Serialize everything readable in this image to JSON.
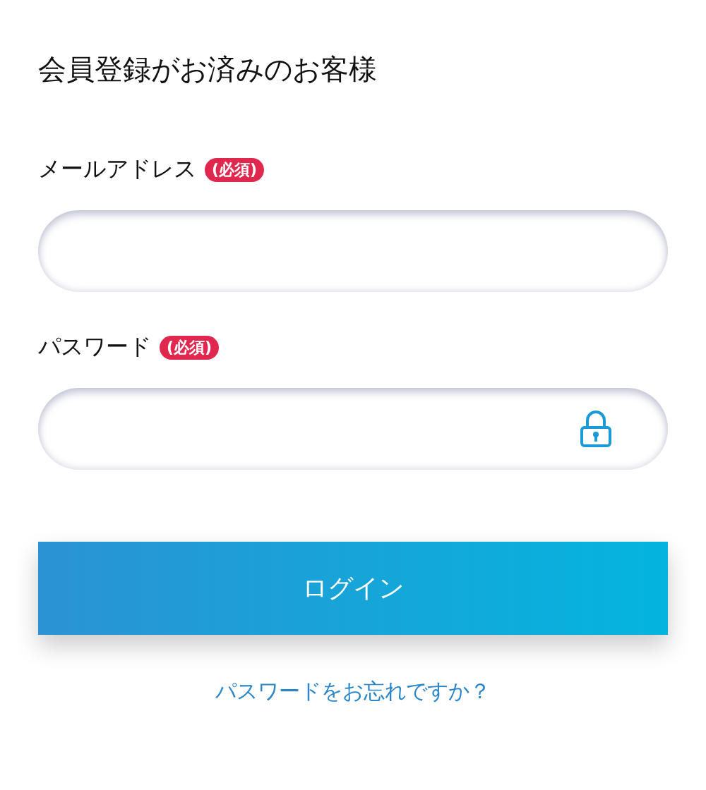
{
  "heading": "会員登録がお済みのお客様",
  "fields": [
    {
      "kind": "email",
      "label": "メールアドレス",
      "badge": "(必須)"
    },
    {
      "kind": "password",
      "label": "パスワード",
      "badge": "(必須)"
    }
  ],
  "login_button": "ログイン",
  "forgot_link": "パスワードをお忘れですか？"
}
